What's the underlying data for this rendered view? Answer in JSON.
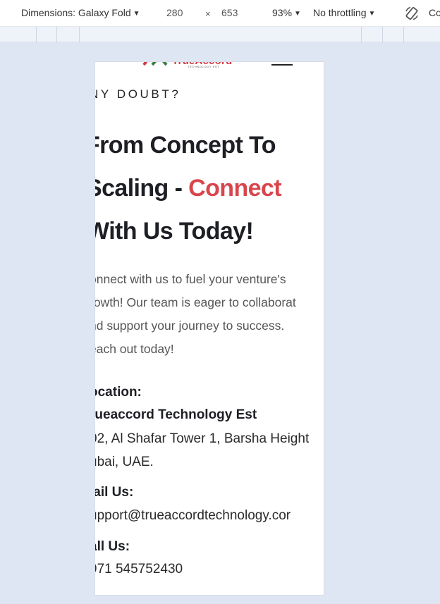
{
  "toolbar": {
    "dimensions_label": "Dimensions: Galaxy Fold",
    "width": "280",
    "times": "×",
    "height": "653",
    "zoom": "93%",
    "throttling": "No throttling",
    "rotate_icon": "rotate-icon",
    "cut_off_label": "Co"
  },
  "site": {
    "logo_text": "TrueAccord",
    "logo_subtext": "TECHNOLOGY EST",
    "eyebrow": "NY DOUBT?",
    "headline": {
      "line1": "From Concept To",
      "line2_start": "Scaling - ",
      "line2_accent": "Connect",
      "line3": "With Us Today!"
    },
    "accent_color": "#d8464c",
    "intro_lines": [
      "onnect with us to fuel your venture's",
      "rowth! Our team is eager to collaborat",
      "nd support your journey to success.",
      "each out today!"
    ],
    "location": {
      "label": "ocation:",
      "company": "rueaccord Technology Est",
      "address_line1": "02, Al Shafar Tower 1, Barsha Height",
      "address_line2": "ubai, UAE."
    },
    "mail": {
      "label": "lail Us:",
      "value": "upport@trueaccordtechnology.cor"
    },
    "call": {
      "label": "all Us:",
      "value": "971  545752430"
    }
  }
}
